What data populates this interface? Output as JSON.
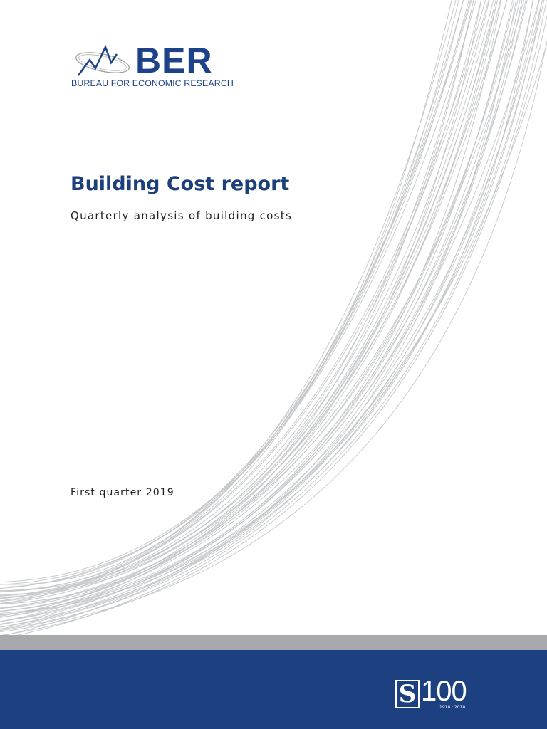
{
  "logo": {
    "acronym": "BER",
    "name": "BUREAU FOR ECONOMIC RESEARCH"
  },
  "title": "Building Cost report",
  "subtitle": "Quarterly analysis of building costs",
  "period": "First quarter 2019",
  "centenary_logo": {
    "mark": "S",
    "number": "100",
    "years": "1918 · 2018"
  },
  "colors": {
    "navy": "#1d4180",
    "grey_band": "#a7a9ac",
    "line": "#c4c6c8"
  }
}
